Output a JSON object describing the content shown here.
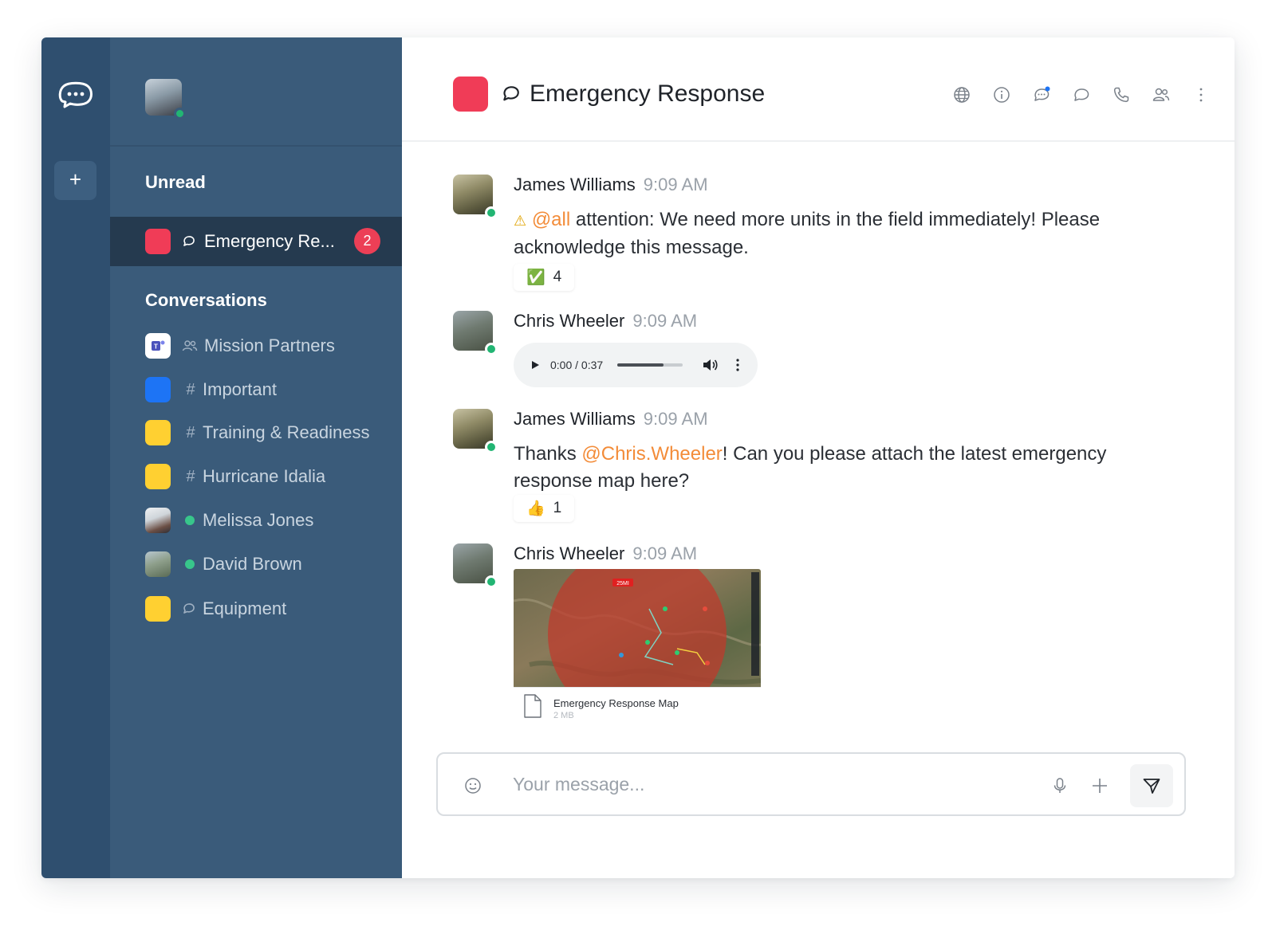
{
  "rail": {
    "add_label": "+"
  },
  "sidebar": {
    "unread_title": "Unread",
    "selected_room": {
      "name": "Emergency Re...",
      "badge": "2",
      "color": "#f03c57"
    },
    "conversations_title": "Conversations",
    "conversations": [
      {
        "name": "Mission Partners",
        "kind": "group-icon",
        "color": "#ffffff"
      },
      {
        "name": "Important",
        "kind": "#",
        "color": "#1d74f5"
      },
      {
        "name": "Training & Readiness",
        "kind": "#",
        "color": "#ffd031"
      },
      {
        "name": "Hurricane Idalia",
        "kind": "#",
        "color": "#ffd031"
      },
      {
        "name": "Melissa Jones",
        "kind": "online",
        "color": "#38c68b"
      },
      {
        "name": "David Brown",
        "kind": "online",
        "color": "#38c68b"
      },
      {
        "name": "Equipment",
        "kind": "discussion-icon",
        "color": "#ffd031"
      }
    ]
  },
  "header": {
    "title": "Emergency Response",
    "room_color": "#f03c57"
  },
  "messages": [
    {
      "author": "James Williams",
      "time": "9:09 AM",
      "warning": "⚠",
      "mention": "@all",
      "text": " attention: We need more units in the field immediately! Please acknowledge this message.",
      "reaction": {
        "emoji": "✅",
        "count": "4"
      }
    },
    {
      "author": "Chris Wheeler",
      "time": "9:09 AM",
      "audio": {
        "time": "0:00 / 0:37",
        "progress": 0.7
      }
    },
    {
      "author": "James Williams",
      "time": "9:09 AM",
      "text_before": "Thanks ",
      "mention": "@Chris.Wheeler",
      "text_after": "! Can you please attach the latest emergency response map here?",
      "reaction": {
        "emoji": "👍",
        "count": "1"
      }
    },
    {
      "author": "Chris Wheeler",
      "time": "9:09 AM",
      "attachment": {
        "name": "Emergency Response Map",
        "size": "2 MB",
        "map_label": "25MI"
      }
    }
  ],
  "composer": {
    "placeholder": "Your message..."
  },
  "colors": {
    "rail": "#2f4f6f",
    "sidebar": "#3a5b7a",
    "accent": "#1d74f5",
    "mention": "#f38c39",
    "online": "#22b573",
    "badge": "#ec3f56"
  }
}
